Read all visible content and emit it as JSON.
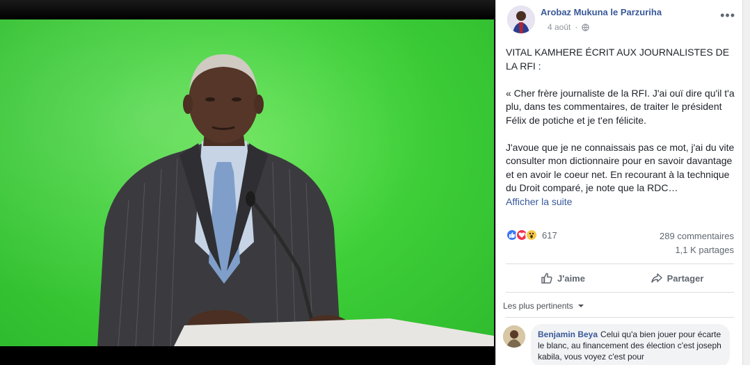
{
  "photo": {
    "alt_icon": "news-anchor-photo"
  },
  "post": {
    "author": "Arobaz Mukuna le Parzuriha",
    "date": "4 août",
    "more": "•••",
    "paragraphs": [
      "VITAL KAMHERE ÉCRIT AUX JOURNALISTES DE LA RFI :",
      "« Cher frère journaliste de la RFI. J'ai ouï dire qu'il t'a plu, dans tes commentaires, de traiter le président Félix de potiche et je t'en félicite.",
      "J'avoue que je ne connaissais pas ce mot, j'ai du vite consulter mon dictionnaire pour en savoir davantage et en avoir le coeur net. En recourant à la technique du Droit comparé, je note que la RDC…"
    ],
    "see_more": "Afficher la suite",
    "reaction_count": "617",
    "comments_count": "289 commentaires",
    "shares_count": "1,1 K partages",
    "like_label": "J'aime",
    "share_label": "Partager",
    "filter_label": "Les plus pertinents"
  },
  "comment": {
    "name": "Benjamin Beya",
    "text": "Celui qu'a bien jouer pour écarte le blanc, au financement des élection c'est joseph kabila, vous voyez c'est pour"
  },
  "colors": {
    "link": "#385898",
    "green_screen": "#3fd039",
    "like": "#3b79f5",
    "love": "#f0334e",
    "wow": "#f7c94a"
  }
}
